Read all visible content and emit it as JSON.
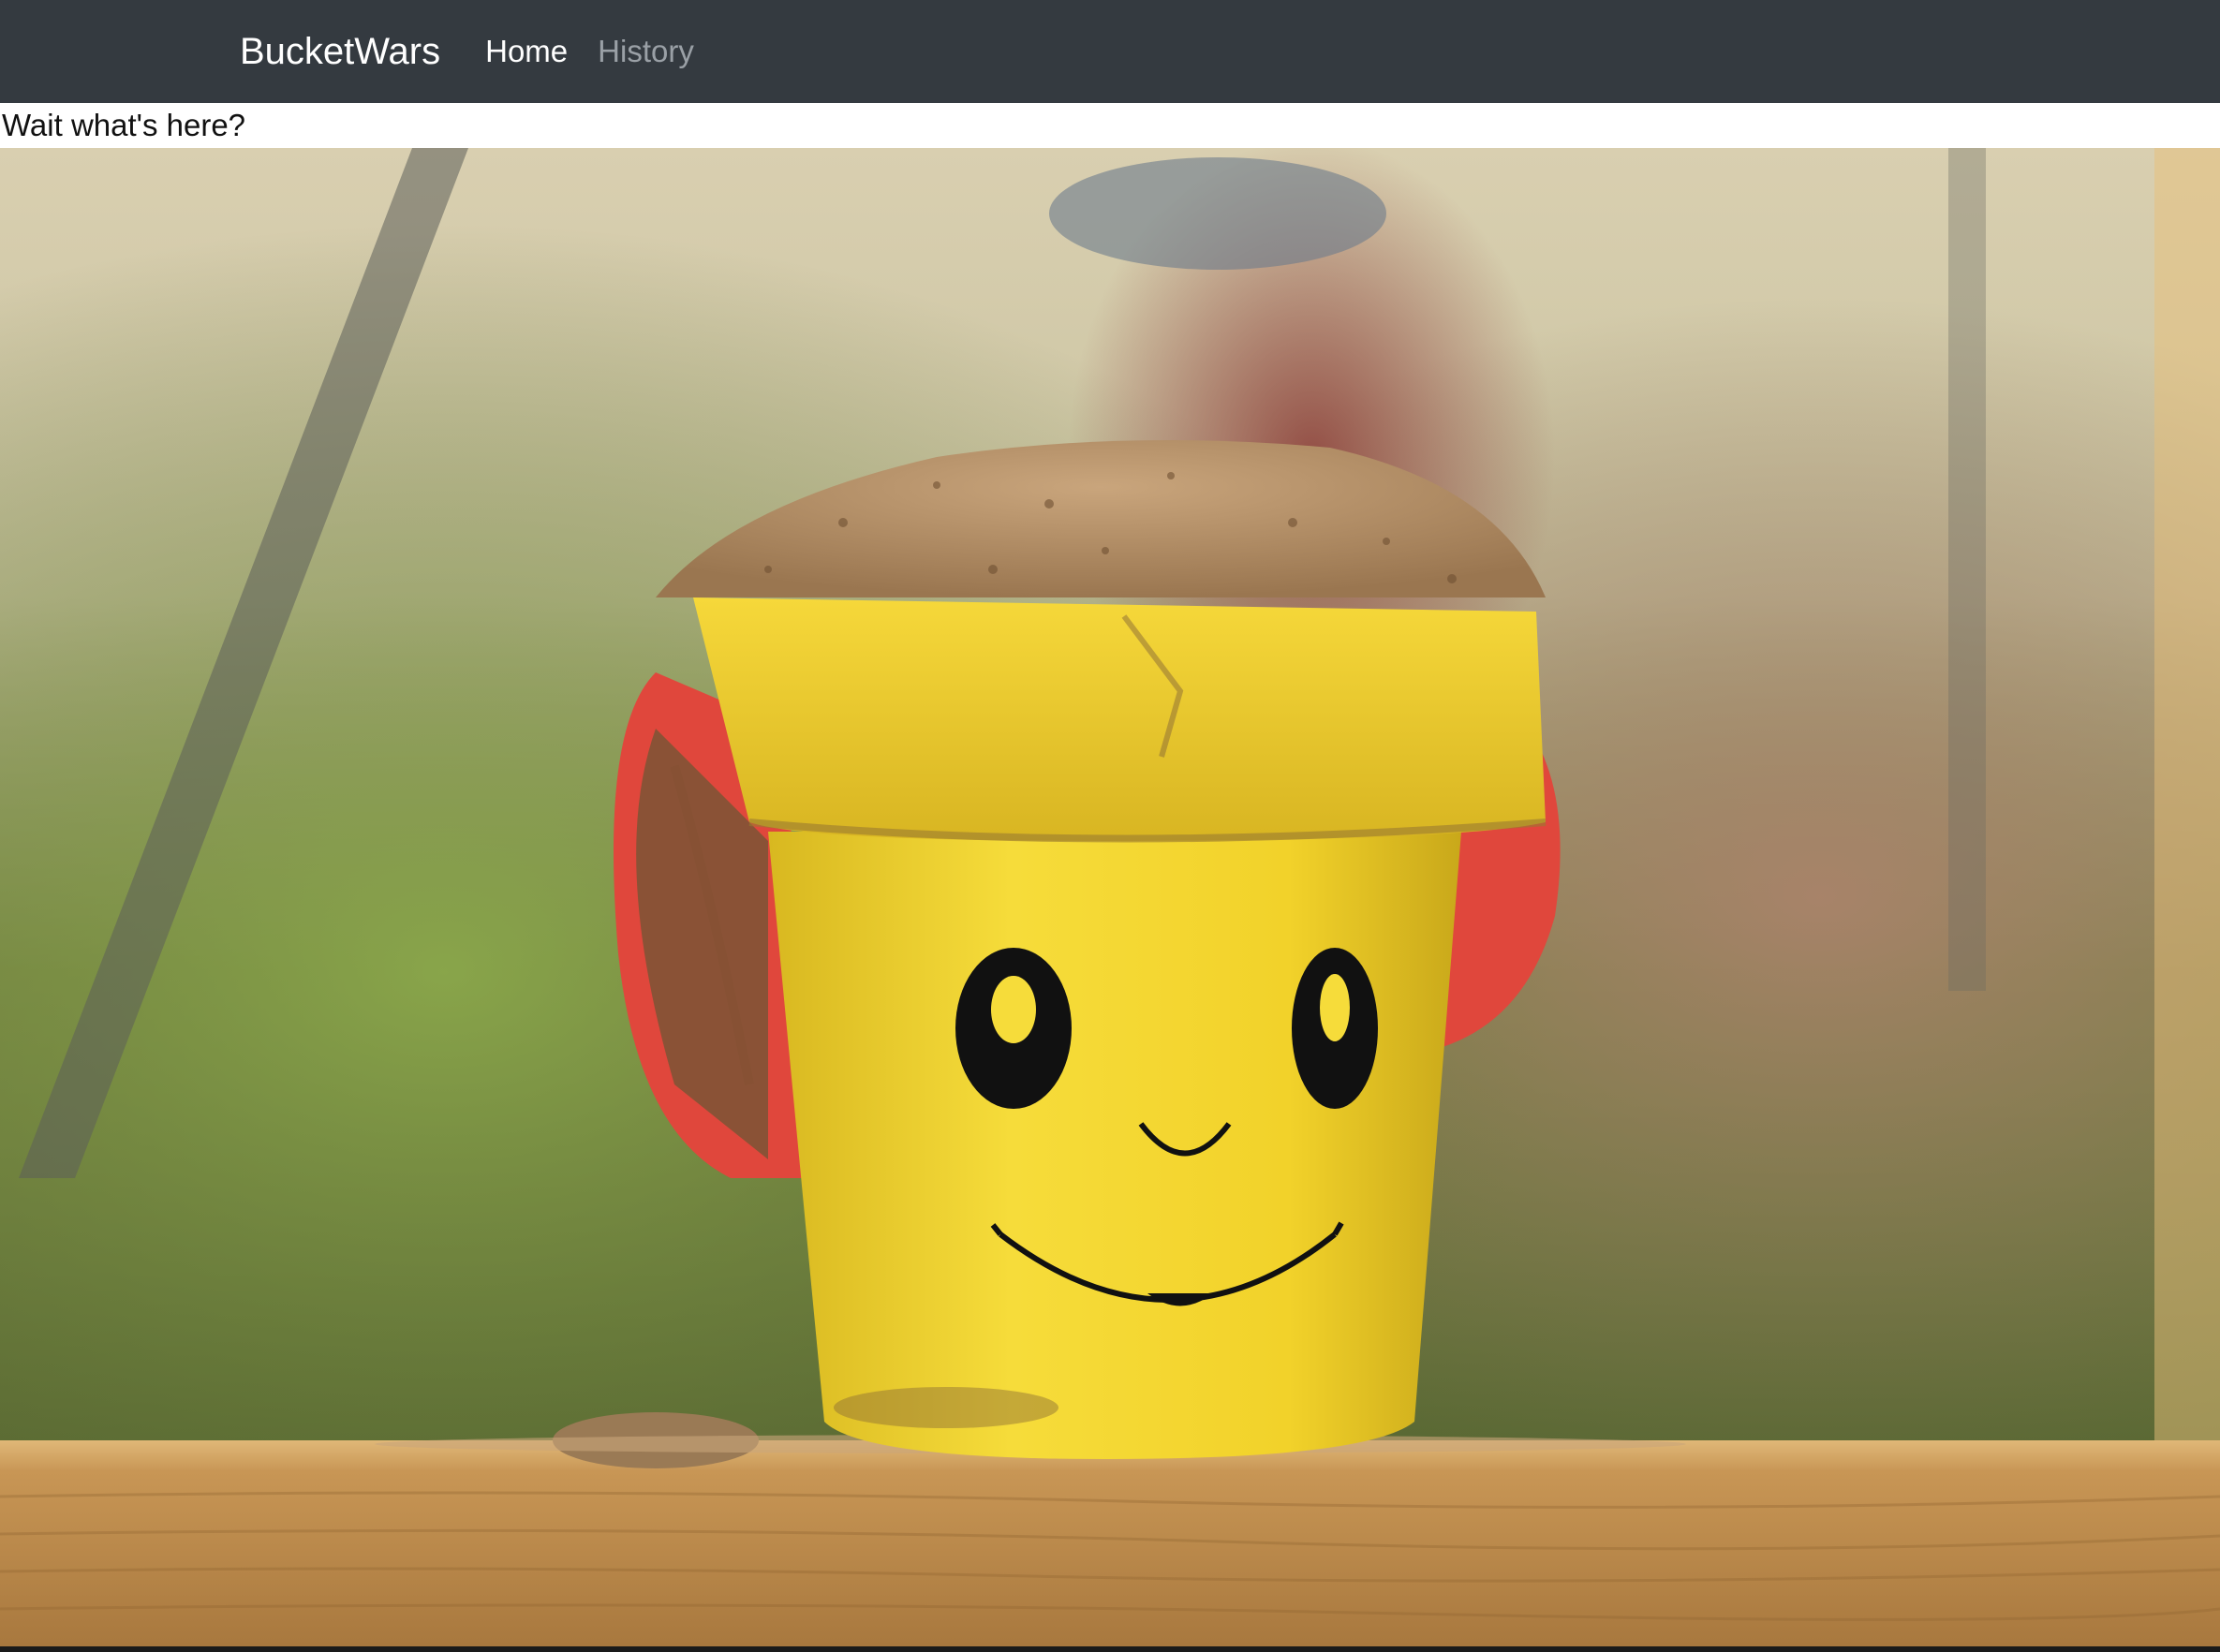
{
  "navbar": {
    "brand": "BucketWars",
    "links": [
      {
        "label": "Home",
        "active": true
      },
      {
        "label": "History",
        "active": false
      }
    ]
  },
  "content": {
    "caption": "Wait what's here?",
    "hero_image": "smiling-yellow-sand-bucket-photo"
  },
  "colors": {
    "navbar_bg": "#343a40",
    "bucket_yellow": "#f2d22a",
    "shovel_red": "#e0473c",
    "sand": "#b08a5e",
    "wood": "#c79a55"
  }
}
